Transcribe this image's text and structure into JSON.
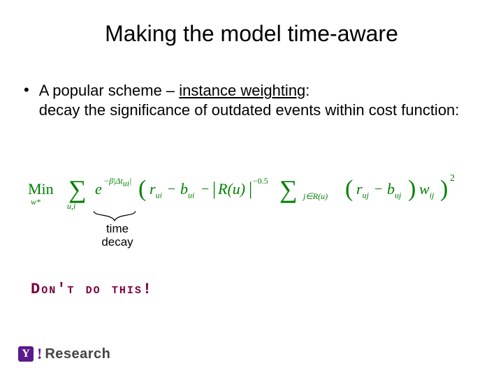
{
  "title": "Making the model time-aware",
  "bullet": {
    "lead": "A popular scheme – ",
    "underlined": "instance weighting",
    "colon": ":",
    "line2": "decay the significance of outdated events within cost function:"
  },
  "formula": {
    "min": "Min",
    "min_sub": "w*",
    "sum1_sub": "u,i",
    "exp_e": "e",
    "exp_sup": "−β|Δt",
    "exp_sup_sub": "ui",
    "exp_sup_end": "|",
    "r_ui": "r",
    "r_ui_sub": "ui",
    "b_ui": "b",
    "b_ui_sub": "ui",
    "Ru": "R(u)",
    "neg_exp": "−0.5",
    "sum2_sub": "j∈R(u)",
    "r_uj": "r",
    "r_uj_sub": "uj",
    "b_uj": "b",
    "b_uj_sub": "uj",
    "w_ij": "w",
    "w_ij_sub": "ij",
    "sq": "2",
    "sigma": "∑",
    "minus": "−",
    "vbar": "|",
    "lparen": "(",
    "rparen": ")"
  },
  "brace_label_l1": "time",
  "brace_label_l2": "decay",
  "warning": "Don't do this!",
  "footer": {
    "y": "Y",
    "excl": "!",
    "research": "Research"
  }
}
